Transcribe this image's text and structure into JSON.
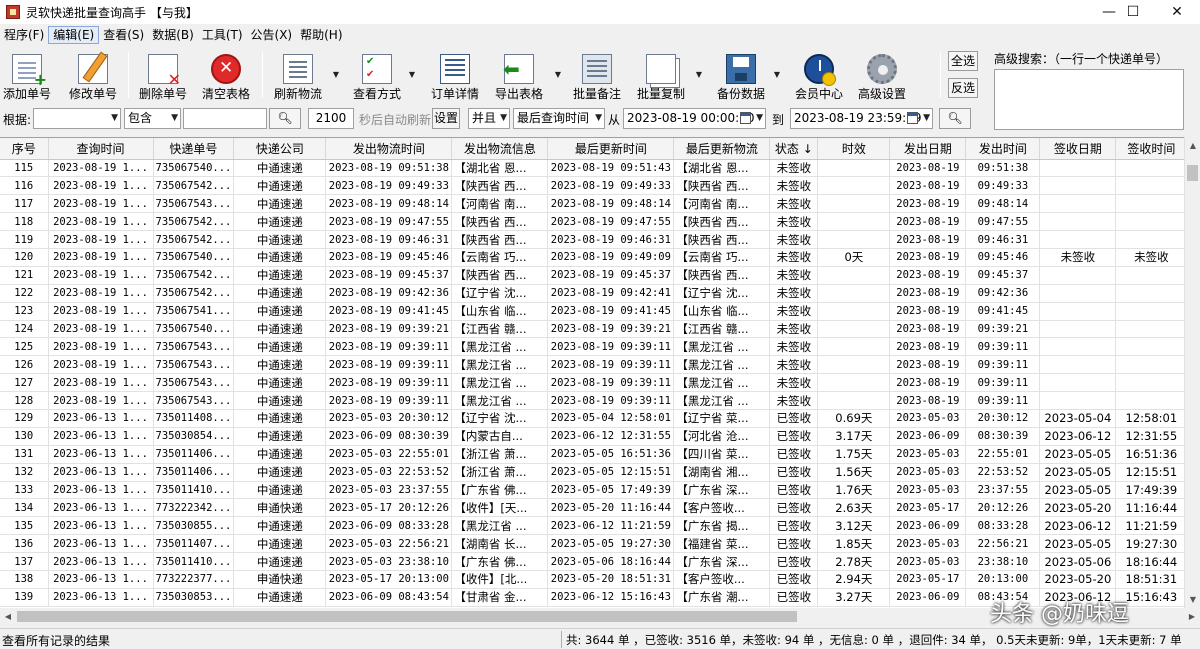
{
  "window": {
    "title": "灵软快递批量查询高手 【与我】",
    "minimize": "—",
    "maximize": "☐",
    "close": "✕"
  },
  "menu": [
    "程序(F)",
    "编辑(E)",
    "查看(S)",
    "数据(B)",
    "工具(T)",
    "公告(X)",
    "帮助(H)"
  ],
  "toolbar": {
    "add": "添加单号",
    "edit": "修改单号",
    "delete": "删除单号",
    "clear": "清空表格",
    "refresh": "刷新物流",
    "view_mode": "查看方式",
    "detail": "订单详情",
    "export": "导出表格",
    "batch_note": "批量备注",
    "batch_copy": "批量复制",
    "backup": "备份数据",
    "member": "会员中心",
    "settings": "高级设置",
    "select_all": "全选",
    "invert": "反选",
    "adv_search_label": "高级搜索：（一行一个快递单号）",
    "adv_search_value": ""
  },
  "filter": {
    "by_label": "根据:",
    "field_value": "",
    "match_mode": "包含",
    "keyword": "",
    "interval": "2100",
    "auto_refresh_label": "秒后自动刷新",
    "set_button": "设置",
    "logic": "并且",
    "time_field": "最后查询时间",
    "from_label": "从",
    "from_value": "2023-08-19 00:00:00",
    "to_label": "到",
    "to_value": "2023-08-19 23:59:59"
  },
  "table": {
    "columns": [
      "序号",
      "查询时间",
      "快递单号",
      "快递公司",
      "发出物流时间",
      "发出物流信息",
      "最后更新时间",
      "最后更新物流",
      "状态 ↓",
      "时效",
      "发出日期",
      "发出时间",
      "签收日期",
      "签收时间"
    ],
    "rows": [
      [
        "115",
        "2023-08-19 1...",
        "735067540...",
        "中通速递",
        "2023-08-19 09:51:38",
        "【湖北省 恩...",
        "2023-08-19 09:51:43",
        "【湖北省 恩...",
        "未签收",
        "",
        "2023-08-19",
        "09:51:38",
        "",
        ""
      ],
      [
        "116",
        "2023-08-19 1...",
        "735067542...",
        "中通速递",
        "2023-08-19 09:49:33",
        "【陕西省 西...",
        "2023-08-19 09:49:33",
        "【陕西省 西...",
        "未签收",
        "",
        "2023-08-19",
        "09:49:33",
        "",
        ""
      ],
      [
        "117",
        "2023-08-19 1...",
        "735067543...",
        "中通速递",
        "2023-08-19 09:48:14",
        "【河南省 南...",
        "2023-08-19 09:48:14",
        "【河南省 南...",
        "未签收",
        "",
        "2023-08-19",
        "09:48:14",
        "",
        ""
      ],
      [
        "118",
        "2023-08-19 1...",
        "735067542...",
        "中通速递",
        "2023-08-19 09:47:55",
        "【陕西省 西...",
        "2023-08-19 09:47:55",
        "【陕西省 西...",
        "未签收",
        "",
        "2023-08-19",
        "09:47:55",
        "",
        ""
      ],
      [
        "119",
        "2023-08-19 1...",
        "735067542...",
        "中通速递",
        "2023-08-19 09:46:31",
        "【陕西省 西...",
        "2023-08-19 09:46:31",
        "【陕西省 西...",
        "未签收",
        "",
        "2023-08-19",
        "09:46:31",
        "",
        ""
      ],
      [
        "120",
        "2023-08-19 1...",
        "735067540...",
        "中通速递",
        "2023-08-19 09:45:46",
        "【云南省 巧...",
        "2023-08-19 09:49:09",
        "【云南省 巧...",
        "未签收",
        "0天",
        "2023-08-19",
        "09:45:46",
        "未签收",
        "未签收"
      ],
      [
        "121",
        "2023-08-19 1...",
        "735067542...",
        "中通速递",
        "2023-08-19 09:45:37",
        "【陕西省 西...",
        "2023-08-19 09:45:37",
        "【陕西省 西...",
        "未签收",
        "",
        "2023-08-19",
        "09:45:37",
        "",
        ""
      ],
      [
        "122",
        "2023-08-19 1...",
        "735067542...",
        "中通速递",
        "2023-08-19 09:42:36",
        "【辽宁省 沈...",
        "2023-08-19 09:42:41",
        "【辽宁省 沈...",
        "未签收",
        "",
        "2023-08-19",
        "09:42:36",
        "",
        ""
      ],
      [
        "123",
        "2023-08-19 1...",
        "735067541...",
        "中通速递",
        "2023-08-19 09:41:45",
        "【山东省 临...",
        "2023-08-19 09:41:45",
        "【山东省 临...",
        "未签收",
        "",
        "2023-08-19",
        "09:41:45",
        "",
        ""
      ],
      [
        "124",
        "2023-08-19 1...",
        "735067540...",
        "中通速递",
        "2023-08-19 09:39:21",
        "【江西省 赣...",
        "2023-08-19 09:39:21",
        "【江西省 赣...",
        "未签收",
        "",
        "2023-08-19",
        "09:39:21",
        "",
        ""
      ],
      [
        "125",
        "2023-08-19 1...",
        "735067543...",
        "中通速递",
        "2023-08-19 09:39:11",
        "【黑龙江省 ...",
        "2023-08-19 09:39:11",
        "【黑龙江省 ...",
        "未签收",
        "",
        "2023-08-19",
        "09:39:11",
        "",
        ""
      ],
      [
        "126",
        "2023-08-19 1...",
        "735067543...",
        "中通速递",
        "2023-08-19 09:39:11",
        "【黑龙江省 ...",
        "2023-08-19 09:39:11",
        "【黑龙江省 ...",
        "未签收",
        "",
        "2023-08-19",
        "09:39:11",
        "",
        ""
      ],
      [
        "127",
        "2023-08-19 1...",
        "735067543...",
        "中通速递",
        "2023-08-19 09:39:11",
        "【黑龙江省 ...",
        "2023-08-19 09:39:11",
        "【黑龙江省 ...",
        "未签收",
        "",
        "2023-08-19",
        "09:39:11",
        "",
        ""
      ],
      [
        "128",
        "2023-08-19 1...",
        "735067543...",
        "中通速递",
        "2023-08-19 09:39:11",
        "【黑龙江省 ...",
        "2023-08-19 09:39:11",
        "【黑龙江省 ...",
        "未签收",
        "",
        "2023-08-19",
        "09:39:11",
        "",
        ""
      ],
      [
        "129",
        "2023-06-13 1...",
        "735011408...",
        "中通速递",
        "2023-05-03 20:30:12",
        "【辽宁省 沈...",
        "2023-05-04 12:58:01",
        "【辽宁省 菜...",
        "已签收",
        "0.69天",
        "2023-05-03",
        "20:30:12",
        "2023-05-04",
        "12:58:01"
      ],
      [
        "130",
        "2023-06-13 1...",
        "735030854...",
        "中通速递",
        "2023-06-09 08:30:39",
        "【内蒙古自...",
        "2023-06-12 12:31:55",
        "【河北省 沧...",
        "已签收",
        "3.17天",
        "2023-06-09",
        "08:30:39",
        "2023-06-12",
        "12:31:55"
      ],
      [
        "131",
        "2023-06-13 1...",
        "735011406...",
        "中通速递",
        "2023-05-03 22:55:01",
        "【浙江省 萧...",
        "2023-05-05 16:51:36",
        "【四川省 菜...",
        "已签收",
        "1.75天",
        "2023-05-03",
        "22:55:01",
        "2023-05-05",
        "16:51:36"
      ],
      [
        "132",
        "2023-06-13 1...",
        "735011406...",
        "中通速递",
        "2023-05-03 22:53:52",
        "【浙江省 萧...",
        "2023-05-05 12:15:51",
        "【湖南省 湘...",
        "已签收",
        "1.56天",
        "2023-05-03",
        "22:53:52",
        "2023-05-05",
        "12:15:51"
      ],
      [
        "133",
        "2023-06-13 1...",
        "735011410...",
        "中通速递",
        "2023-05-03 23:37:55",
        "【广东省 佛...",
        "2023-05-05 17:49:39",
        "【广东省 深...",
        "已签收",
        "1.76天",
        "2023-05-03",
        "23:37:55",
        "2023-05-05",
        "17:49:39"
      ],
      [
        "134",
        "2023-06-13 1...",
        "773222342...",
        "申通快递",
        "2023-05-17 20:12:26",
        "【收件】[天...",
        "2023-05-20 11:16:44",
        "【客户签收...",
        "已签收",
        "2.63天",
        "2023-05-17",
        "20:12:26",
        "2023-05-20",
        "11:16:44"
      ],
      [
        "135",
        "2023-06-13 1...",
        "735030855...",
        "中通速递",
        "2023-06-09 08:33:28",
        "【黑龙江省 ...",
        "2023-06-12 11:21:59",
        "【广东省 揭...",
        "已签收",
        "3.12天",
        "2023-06-09",
        "08:33:28",
        "2023-06-12",
        "11:21:59"
      ],
      [
        "136",
        "2023-06-13 1...",
        "735011407...",
        "中通速递",
        "2023-05-03 22:56:21",
        "【湖南省 长...",
        "2023-05-05 19:27:30",
        "【福建省 菜...",
        "已签收",
        "1.85天",
        "2023-05-03",
        "22:56:21",
        "2023-05-05",
        "19:27:30"
      ],
      [
        "137",
        "2023-06-13 1...",
        "735011410...",
        "中通速递",
        "2023-05-03 23:38:10",
        "【广东省 佛...",
        "2023-05-06 18:16:44",
        "【广东省 深...",
        "已签收",
        "2.78天",
        "2023-05-03",
        "23:38:10",
        "2023-05-06",
        "18:16:44"
      ],
      [
        "138",
        "2023-06-13 1...",
        "773222377...",
        "申通快递",
        "2023-05-17 20:13:00",
        "【收件】[北...",
        "2023-05-20 18:51:31",
        "【客户签收...",
        "已签收",
        "2.94天",
        "2023-05-17",
        "20:13:00",
        "2023-05-20",
        "18:51:31"
      ],
      [
        "139",
        "2023-06-13 1...",
        "735030853...",
        "中通速递",
        "2023-06-09 08:43:54",
        "【甘肃省 金...",
        "2023-06-12 15:16:43",
        "【广东省 潮...",
        "已签收",
        "3.27天",
        "2023-06-09",
        "08:43:54",
        "2023-06-12",
        "15:16:43"
      ]
    ]
  },
  "status": {
    "left": "查看所有记录的结果",
    "right": "共: 3644 单 ，已签收:  3516 单，未签收:  94 单 ，无信息: 0 单 ，退回件: 34 单，  0.5天未更新: 9单，1天未更新: 7 单"
  },
  "watermark": "头条 @奶味逗"
}
